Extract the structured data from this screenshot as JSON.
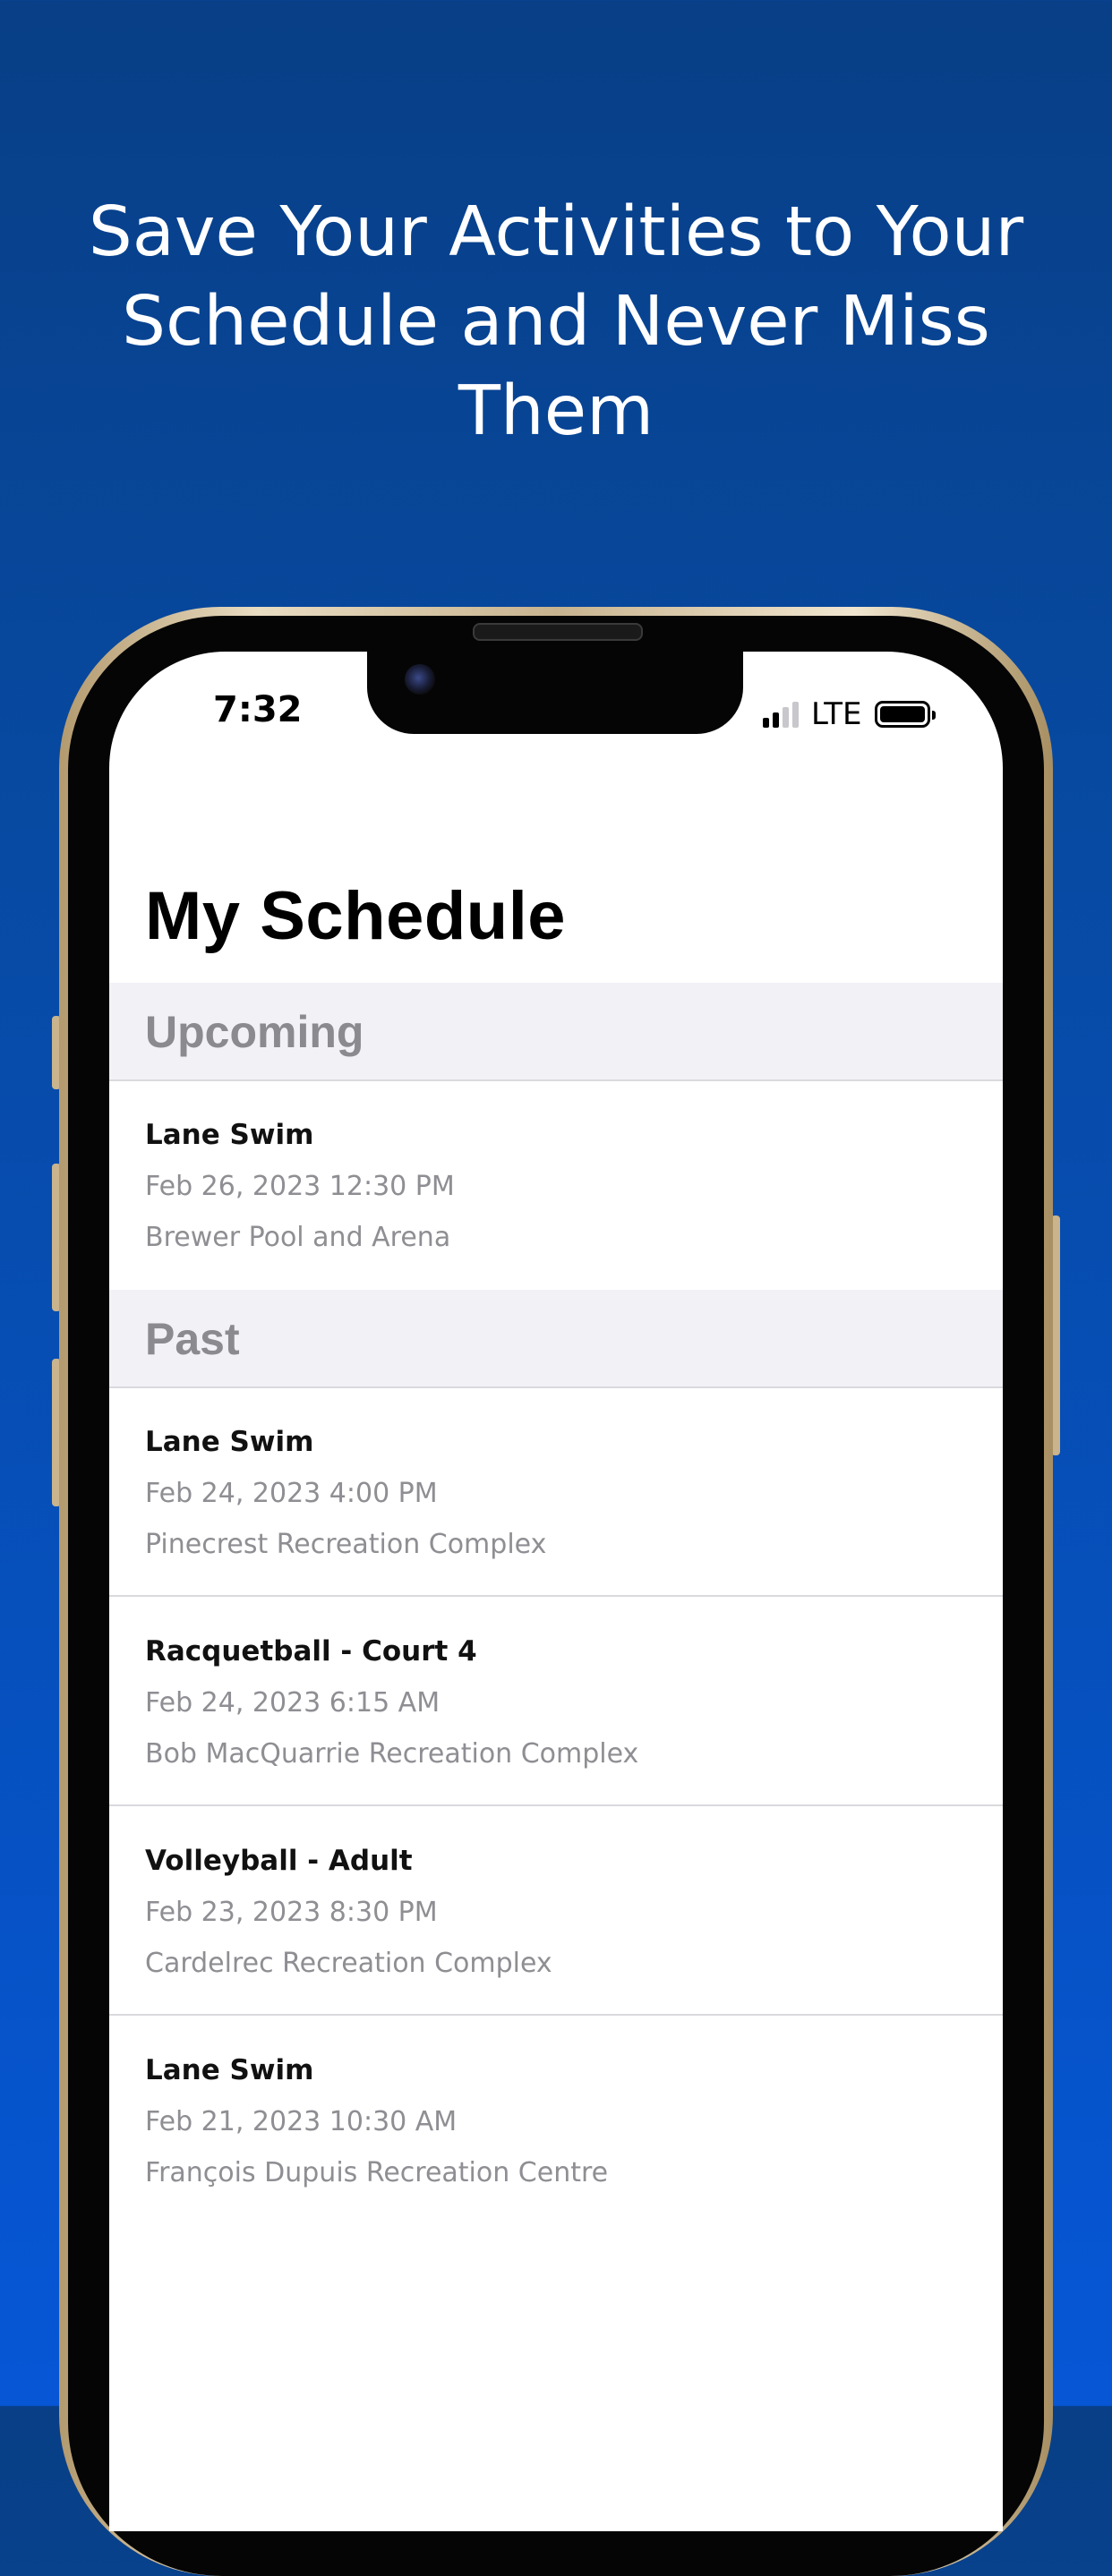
{
  "headline": {
    "line1": "Save Your Activities to Your",
    "line2": "Schedule and Never Miss",
    "line3": "Them"
  },
  "status_bar": {
    "time": "7:32",
    "network": "LTE",
    "signal_bars_active": 2,
    "signal_bars_total": 4,
    "battery_level": 1.0
  },
  "page": {
    "title": "My Schedule"
  },
  "sections": {
    "upcoming": {
      "label": "Upcoming",
      "items": [
        {
          "title": "Lane Swim",
          "datetime": "Feb 26, 2023 12:30 PM",
          "location": "Brewer Pool and Arena"
        }
      ]
    },
    "past": {
      "label": "Past",
      "items": [
        {
          "title": "Lane Swim",
          "datetime": "Feb 24, 2023 4:00 PM",
          "location": "Pinecrest Recreation Complex"
        },
        {
          "title": "Racquetball - Court 4",
          "datetime": "Feb 24, 2023 6:15 AM",
          "location": "Bob MacQuarrie Recreation Complex"
        },
        {
          "title": "Volleyball - Adult",
          "datetime": "Feb 23, 2023 8:30 PM",
          "location": "Cardelrec Recreation Complex"
        },
        {
          "title": "Lane Swim",
          "datetime": "Feb 21, 2023 10:30 AM",
          "location": "François Dupuis Recreation Centre"
        }
      ]
    }
  },
  "colors": {
    "background_top": "#083f86",
    "background_bottom": "#0656d6",
    "section_header_bg": "#f1f1f6",
    "secondary_text": "#8e8e93"
  }
}
